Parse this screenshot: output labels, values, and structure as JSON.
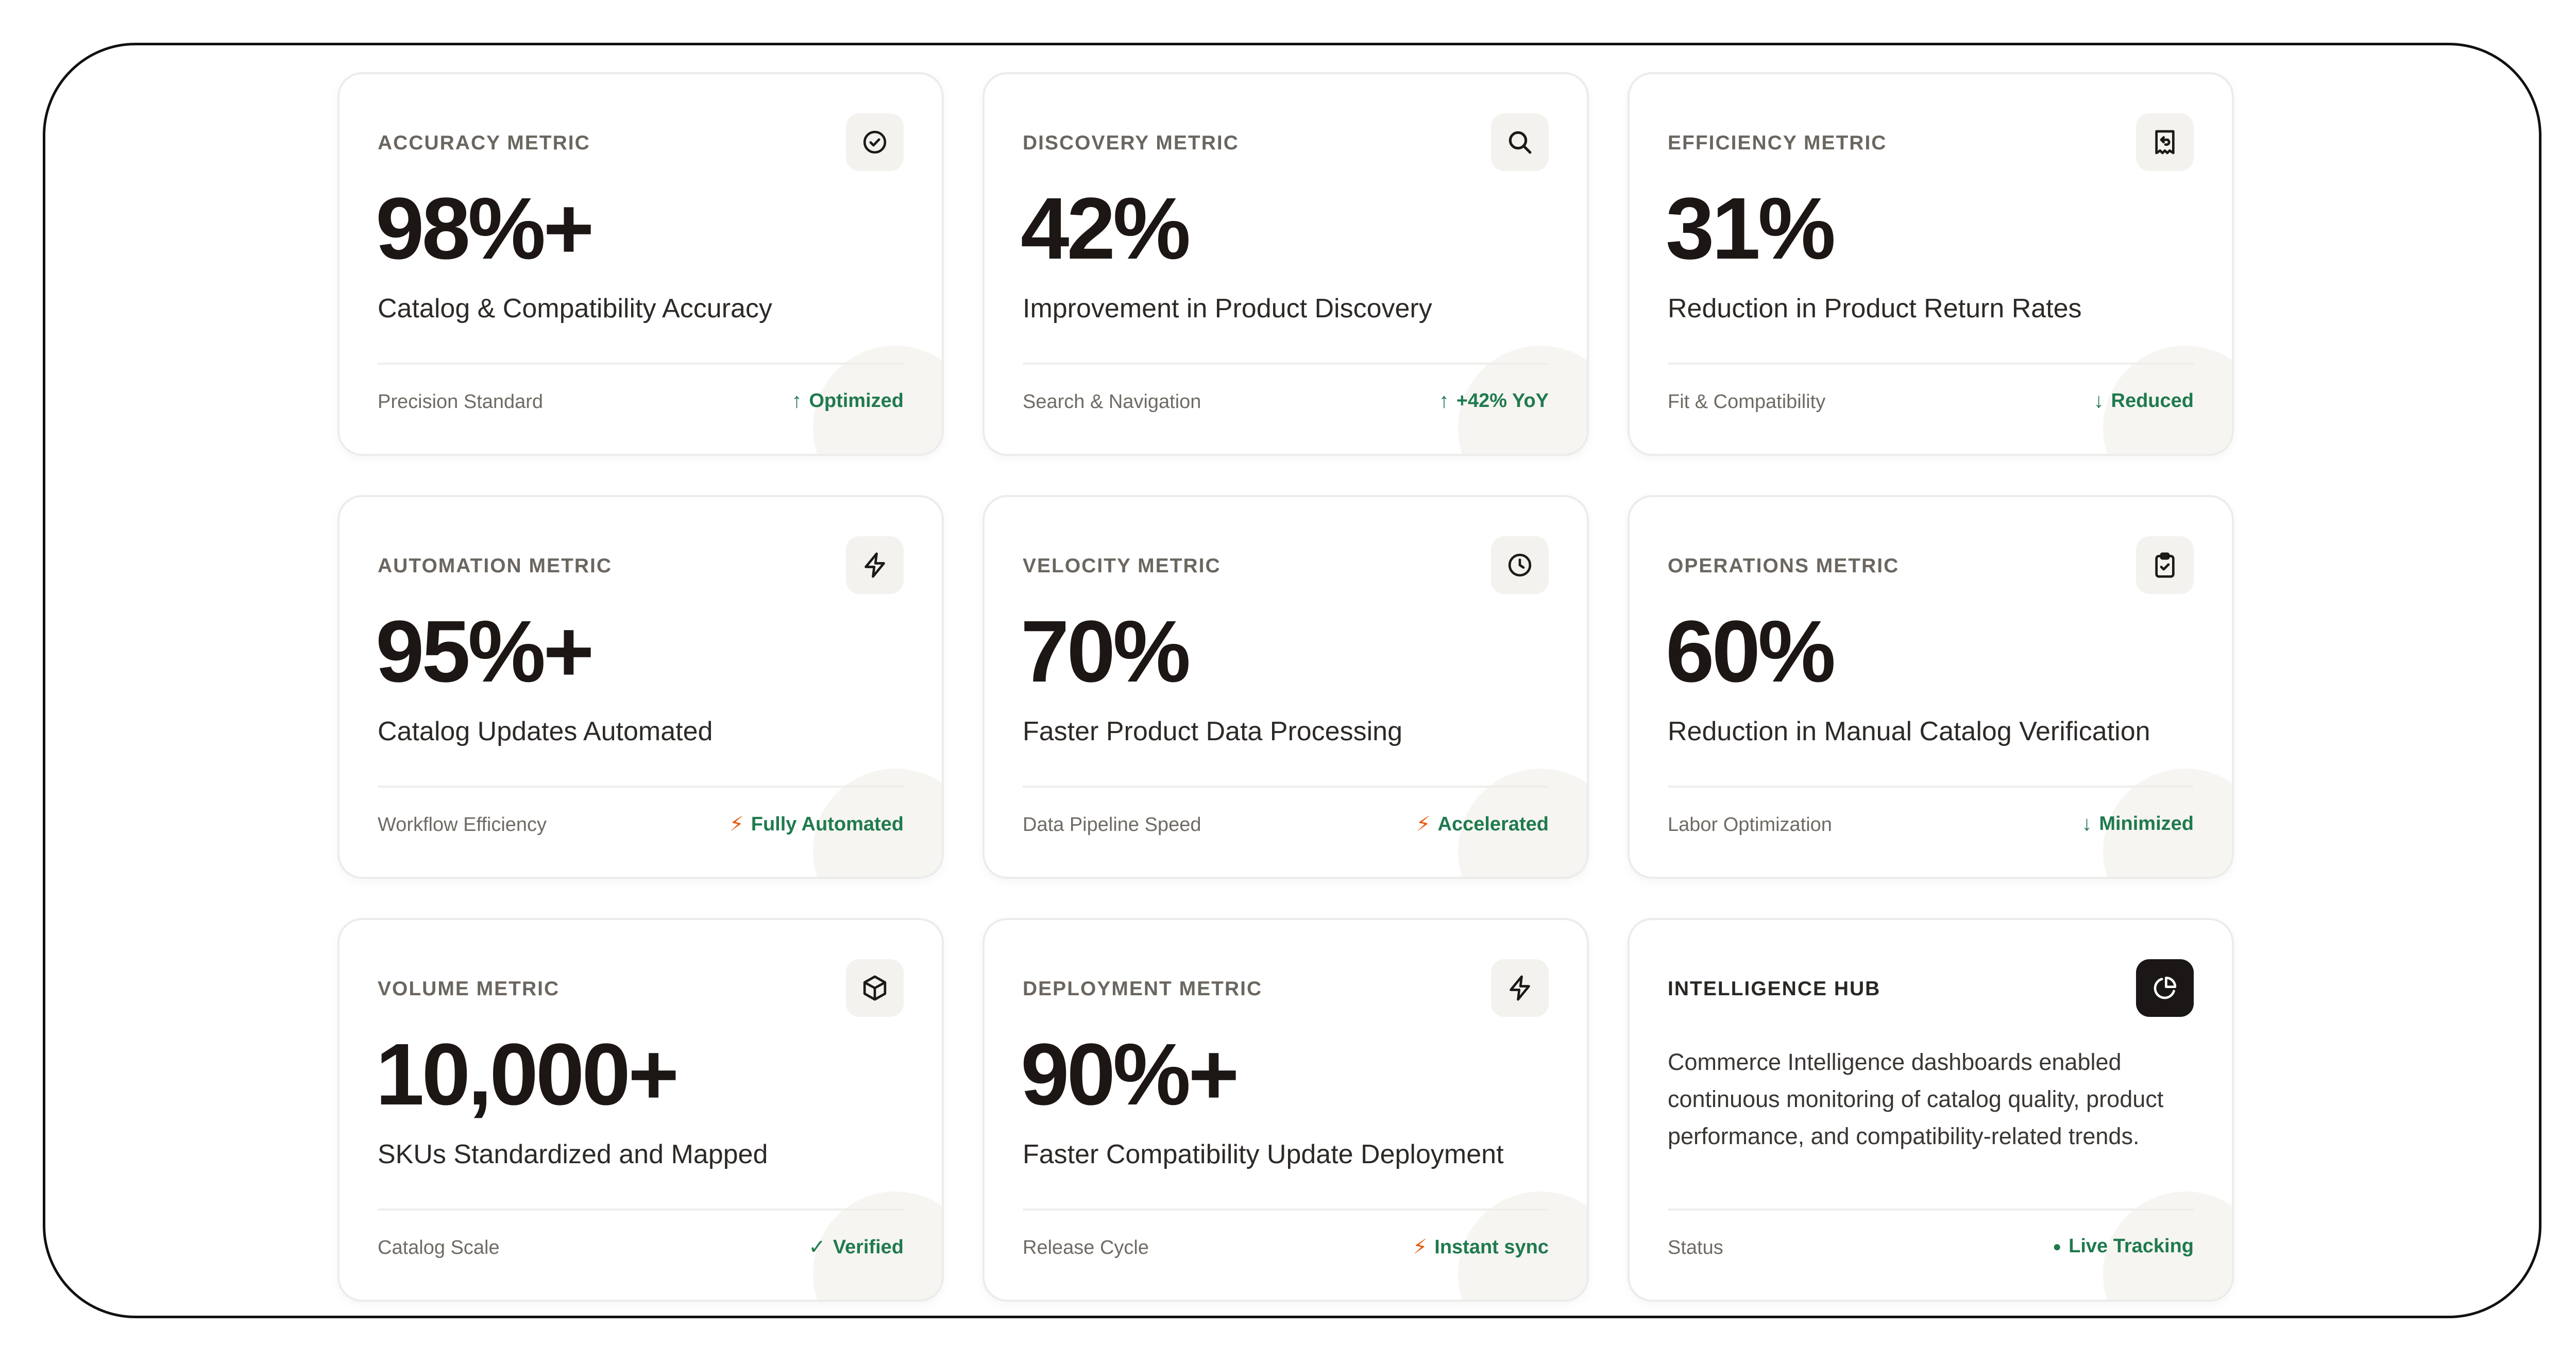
{
  "colors": {
    "accent_green": "#1f7a4d",
    "bolt_orange": "#ea580c",
    "text_dark": "#1c1714",
    "muted": "#6f6a64"
  },
  "cards": [
    {
      "label": "ACCURACY METRIC",
      "icon": "check-circle-icon",
      "value": "98%+",
      "desc": "Catalog & Compatibility Accuracy",
      "foot_left": "Precision Standard",
      "foot_symbol": "↑",
      "foot_right": "Optimized"
    },
    {
      "label": "DISCOVERY METRIC",
      "icon": "search-icon",
      "value": "42%",
      "desc": "Improvement in Product Discovery",
      "foot_left": "Search & Navigation",
      "foot_symbol": "↑",
      "foot_right": "+42% YoY"
    },
    {
      "label": "EFFICIENCY METRIC",
      "icon": "receipt-return-icon",
      "value": "31%",
      "desc": "Reduction in Product Return Rates",
      "foot_left": "Fit & Compatibility",
      "foot_symbol": "↓",
      "foot_right": "Reduced"
    },
    {
      "label": "AUTOMATION METRIC",
      "icon": "lightning-icon",
      "value": "95%+",
      "desc": "Catalog Updates Automated",
      "foot_left": "Workflow Efficiency",
      "foot_symbol": "⚡",
      "foot_right": "Fully Automated"
    },
    {
      "label": "VELOCITY METRIC",
      "icon": "clock-icon",
      "value": "70%",
      "desc": "Faster Product Data Processing",
      "foot_left": "Data Pipeline Speed",
      "foot_symbol": "⚡",
      "foot_right": "Accelerated"
    },
    {
      "label": "OPERATIONS METRIC",
      "icon": "clipboard-check-icon",
      "value": "60%",
      "desc": "Reduction in Manual Catalog Verification",
      "foot_left": "Labor Optimization",
      "foot_symbol": "↓",
      "foot_right": "Minimized"
    },
    {
      "label": "VOLUME METRIC",
      "icon": "box-icon",
      "value": "10,000+",
      "desc": "SKUs Standardized and Mapped",
      "foot_left": "Catalog Scale",
      "foot_symbol": "✓",
      "foot_right": "Verified"
    },
    {
      "label": "DEPLOYMENT METRIC",
      "icon": "lightning-icon",
      "value": "90%+",
      "desc": "Faster Compatibility Update Deployment",
      "foot_left": "Release Cycle",
      "foot_symbol": "⚡",
      "foot_right": "Instant sync"
    },
    {
      "label": "INTELLIGENCE HUB",
      "icon": "pie-chart-icon",
      "paragraph": "Commerce Intelligence dashboards enabled continuous monitoring of catalog quality, product performance, and compatibility-related trends.",
      "foot_left": "Status",
      "foot_symbol": "●",
      "foot_right": "Live Tracking"
    }
  ]
}
